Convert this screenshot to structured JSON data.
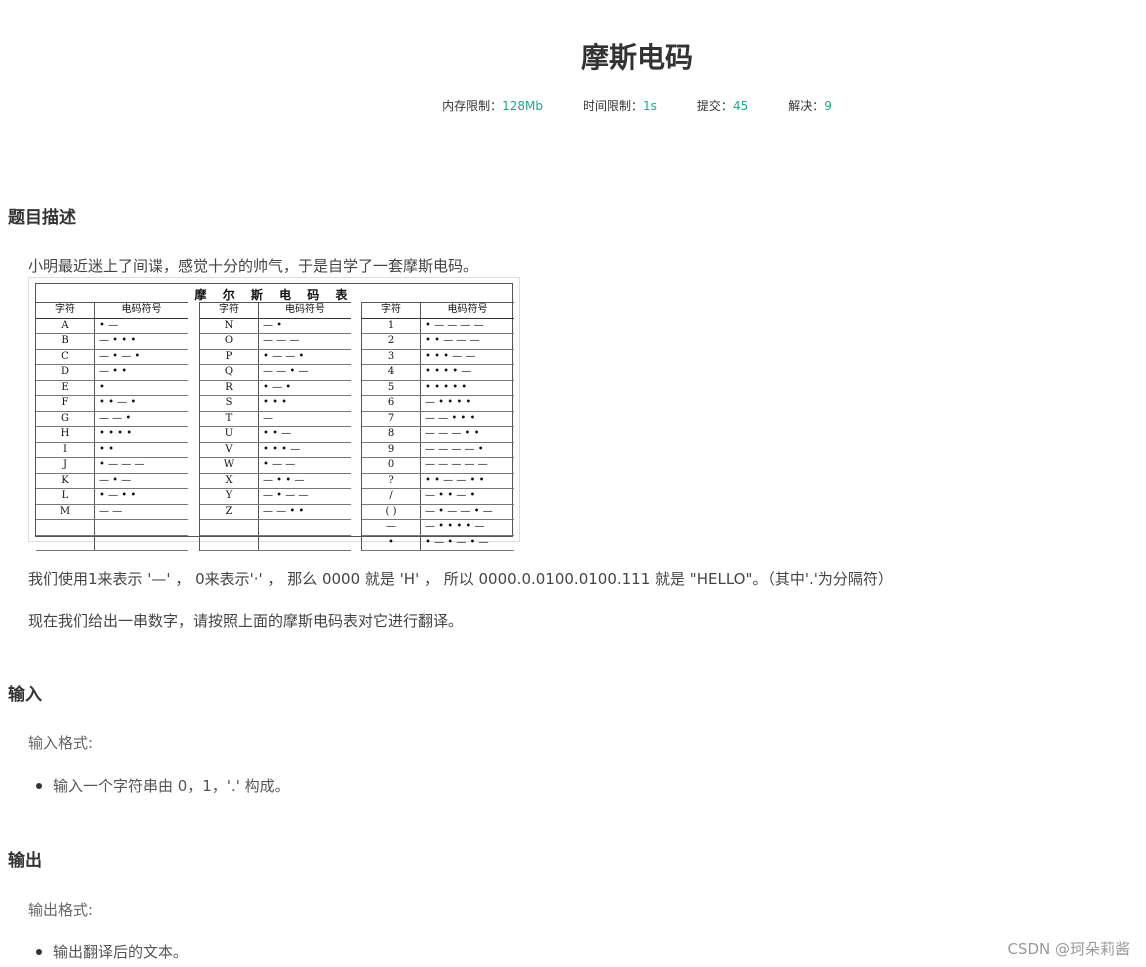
{
  "problem": {
    "title": "摩斯电码",
    "meta": [
      {
        "label": "内存限制：",
        "value": "128Mb"
      },
      {
        "label": "时间限制：",
        "value": "1s"
      },
      {
        "label": "提交：",
        "value": "45"
      },
      {
        "label": "解决：",
        "value": "9"
      }
    ]
  },
  "description": {
    "heading": "题目描述",
    "intro": "小明最近迷上了间谍，感觉十分的帅气，于是自学了一套摩斯电码。",
    "para1": "我们使用1来表示 '—' ， 0来表示'·' ， 那么 0000 就是 'H' ， 所以 0000.0.0100.0100.111 就是 \"HELLO\"。（其中'.'为分隔符）",
    "para2": "现在我们给出一串数字，请按照上面的摩斯电码表对它进行翻译。"
  },
  "morse_table": {
    "title": "摩 尔 斯 电 码 表",
    "col_char": "字符",
    "col_code": "电码符号",
    "col1": [
      [
        "A",
        "• —"
      ],
      [
        "B",
        "— • • •"
      ],
      [
        "C",
        "— • — •"
      ],
      [
        "D",
        "— • •"
      ],
      [
        "E",
        "•"
      ],
      [
        "F",
        "• • — •"
      ],
      [
        "G",
        "— — •"
      ],
      [
        "H",
        "• • • •"
      ],
      [
        "I",
        "• •"
      ],
      [
        "J",
        "• — — —"
      ],
      [
        "K",
        "— • —"
      ],
      [
        "L",
        "• — • •"
      ],
      [
        "M",
        "— —"
      ],
      [
        "",
        ""
      ],
      [
        "",
        ""
      ]
    ],
    "col2": [
      [
        "N",
        "— •"
      ],
      [
        "O",
        "— — —"
      ],
      [
        "P",
        "• — — •"
      ],
      [
        "Q",
        "— — • —"
      ],
      [
        "R",
        "• — •"
      ],
      [
        "S",
        "• • •"
      ],
      [
        "T",
        "—"
      ],
      [
        "U",
        "• • —"
      ],
      [
        "V",
        "• • • —"
      ],
      [
        "W",
        "• — —"
      ],
      [
        "X",
        "— • • —"
      ],
      [
        "Y",
        "— • — —"
      ],
      [
        "Z",
        "— — • •"
      ],
      [
        "",
        ""
      ],
      [
        "",
        ""
      ]
    ],
    "col3": [
      [
        "1",
        "• — — — —"
      ],
      [
        "2",
        "• • — — —"
      ],
      [
        "3",
        "• • • — —"
      ],
      [
        "4",
        "• • • • —"
      ],
      [
        "5",
        "• • • • •"
      ],
      [
        "6",
        "— • • • •"
      ],
      [
        "7",
        "— — • • •"
      ],
      [
        "8",
        "— — — • •"
      ],
      [
        "9",
        "— — — — •"
      ],
      [
        "0",
        "— — — — —"
      ],
      [
        "?",
        "• • — — • •"
      ],
      [
        "/",
        "— • • — •"
      ],
      [
        "( )",
        "— • — — • —"
      ],
      [
        "—",
        "— • • • • —"
      ],
      [
        "•",
        "• — • — • —"
      ]
    ]
  },
  "input": {
    "heading": "输入",
    "format_label": "输入格式:",
    "items": [
      "输入一个字符串由 0，1，'.' 构成。"
    ]
  },
  "output": {
    "heading": "输出",
    "format_label": "输出格式:",
    "items": [
      "输出翻译后的文本。"
    ]
  },
  "watermark": "CSDN @珂朵莉酱"
}
